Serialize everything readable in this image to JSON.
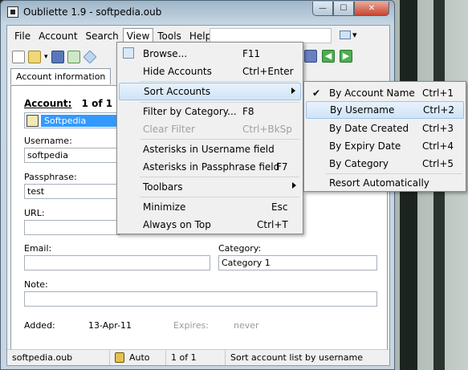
{
  "window": {
    "title": "Oubliette 1.9 - softpedia.oub"
  },
  "menubar": {
    "items": [
      "File",
      "Account",
      "Search",
      "View",
      "Tools",
      "Help"
    ]
  },
  "tabs": {
    "active": "Account information"
  },
  "account": {
    "header": "Account:",
    "position": "1 of 1",
    "selected": "Softpedia",
    "username_label": "Username:",
    "username_value": "softpedia",
    "passphrase_label": "Passphrase:",
    "passphrase_value": "test",
    "url_label": "URL:",
    "url_value": "",
    "email_label": "Email:",
    "email_value": "",
    "category_label": "Category:",
    "category_value": "Category 1",
    "note_label": "Note:",
    "note_value": "",
    "added_label": "Added:",
    "added_value": "13-Apr-11",
    "expires_label": "Expires:",
    "expires_value": "never"
  },
  "statusbar": {
    "file": "softpedia.oub",
    "lock_mode": "Auto",
    "position": "1 of 1",
    "message": "Sort account list by username"
  },
  "view_menu": [
    {
      "label": "Browse...",
      "shortcut": "F11",
      "icon": "browse-icon"
    },
    {
      "label": "Hide Accounts",
      "shortcut": "Ctrl+Enter"
    },
    {
      "label": "Sort Accounts",
      "shortcut": "",
      "submenu": true
    },
    {
      "label": "Filter by Category...",
      "shortcut": "F8"
    },
    {
      "label": "Clear Filter",
      "shortcut": "Ctrl+BkSp",
      "disabled": true
    },
    {
      "label": "Asterisks in Username field",
      "shortcut": ""
    },
    {
      "label": "Asterisks in Passphrase field",
      "shortcut": "F7"
    },
    {
      "label": "Toolbars",
      "shortcut": "",
      "submenu": true
    },
    {
      "label": "Minimize",
      "shortcut": "Esc"
    },
    {
      "label": "Always on Top",
      "shortcut": "Ctrl+T"
    }
  ],
  "sort_menu": [
    {
      "label": "By Account Name",
      "shortcut": "Ctrl+1",
      "checked": true
    },
    {
      "label": "By Username",
      "shortcut": "Ctrl+2",
      "highlighted": true
    },
    {
      "label": "By Date Created",
      "shortcut": "Ctrl+3"
    },
    {
      "label": "By Expiry Date",
      "shortcut": "Ctrl+4"
    },
    {
      "label": "By Category",
      "shortcut": "Ctrl+5"
    },
    {
      "label": "Resort Automatically",
      "shortcut": ""
    }
  ],
  "colors": {
    "highlight": "#cfe4f8",
    "selection": "#3399ff"
  }
}
